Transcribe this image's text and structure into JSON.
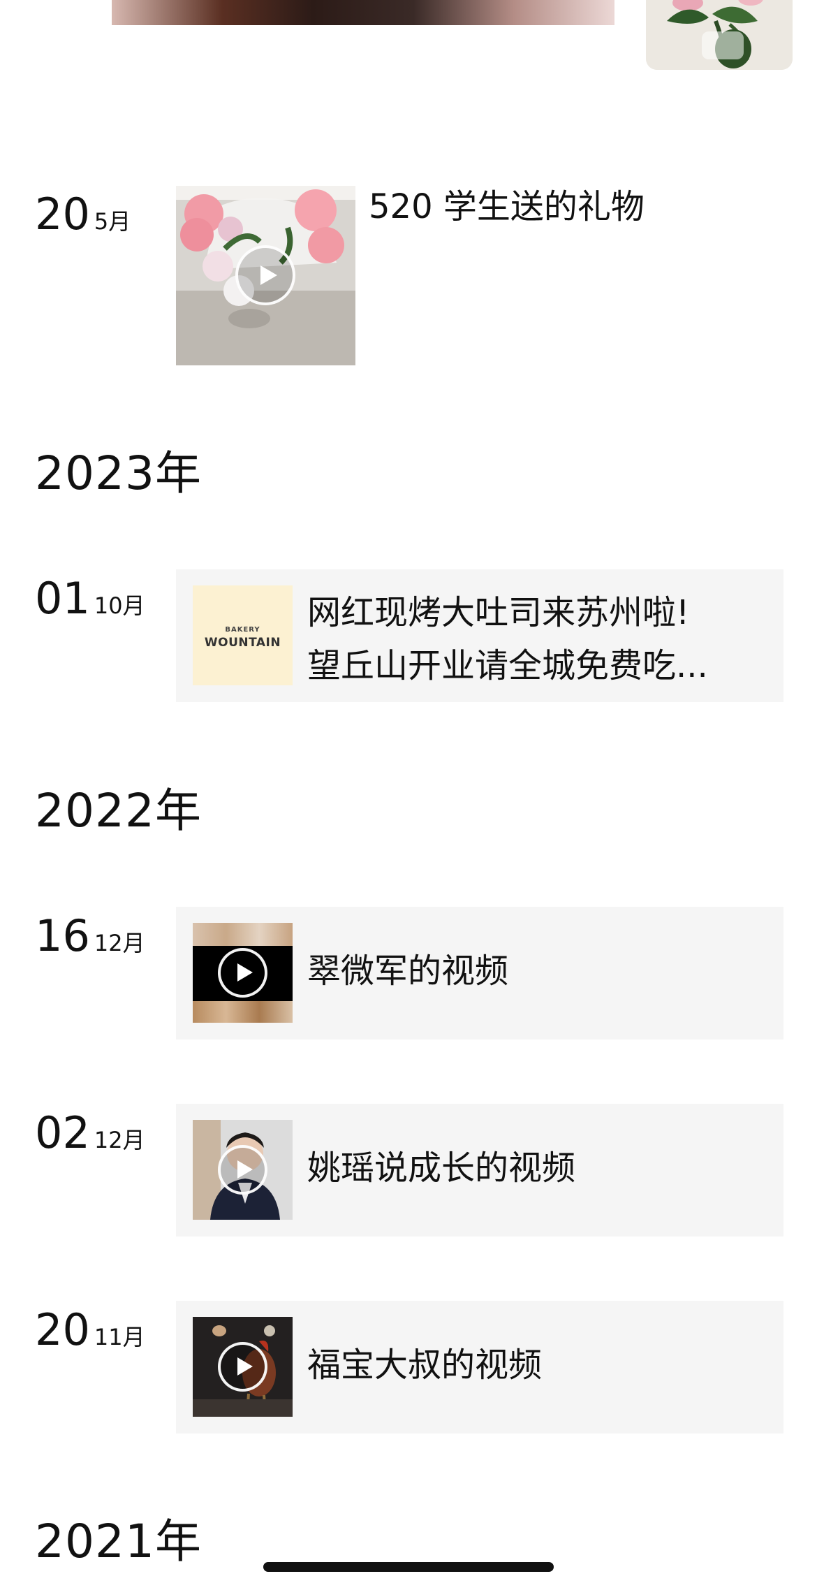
{
  "top_photos": {
    "left_image": "cropped-photo",
    "right_image": "flower-vase-photo"
  },
  "timeline": [
    {
      "kind": "plain",
      "day": "20",
      "month": "5月",
      "text": "520 学生送的礼物",
      "thumbnail": "roses-video",
      "is_video": true
    },
    {
      "kind": "year",
      "label": "2023年"
    },
    {
      "kind": "card",
      "day": "01",
      "month": "10月",
      "title_line1": "网红现烤大吐司来苏州啦!",
      "title_line2": "望丘山开业请全城免费吃...",
      "thumbnail": "bakery-logo",
      "logo_small": "BAKERY",
      "logo_big": "WOUNTAIN",
      "is_video": false
    },
    {
      "kind": "year",
      "label": "2022年"
    },
    {
      "kind": "card",
      "day": "16",
      "month": "12月",
      "title": "翠微军的视频",
      "thumbnail": "video-thumb-blurred",
      "is_video": true
    },
    {
      "kind": "card",
      "day": "02",
      "month": "12月",
      "title": "姚瑶说成长的视频",
      "thumbnail": "video-thumb-woman-speaker",
      "is_video": true
    },
    {
      "kind": "card",
      "day": "20",
      "month": "11月",
      "title": "福宝大叔的视频",
      "thumbnail": "video-thumb-rooster",
      "is_video": true
    },
    {
      "kind": "year",
      "label": "2021年"
    }
  ],
  "colors": {
    "card_bg": "#f5f5f5",
    "text": "#111111",
    "bakery_bg": "#fcf1d2"
  }
}
